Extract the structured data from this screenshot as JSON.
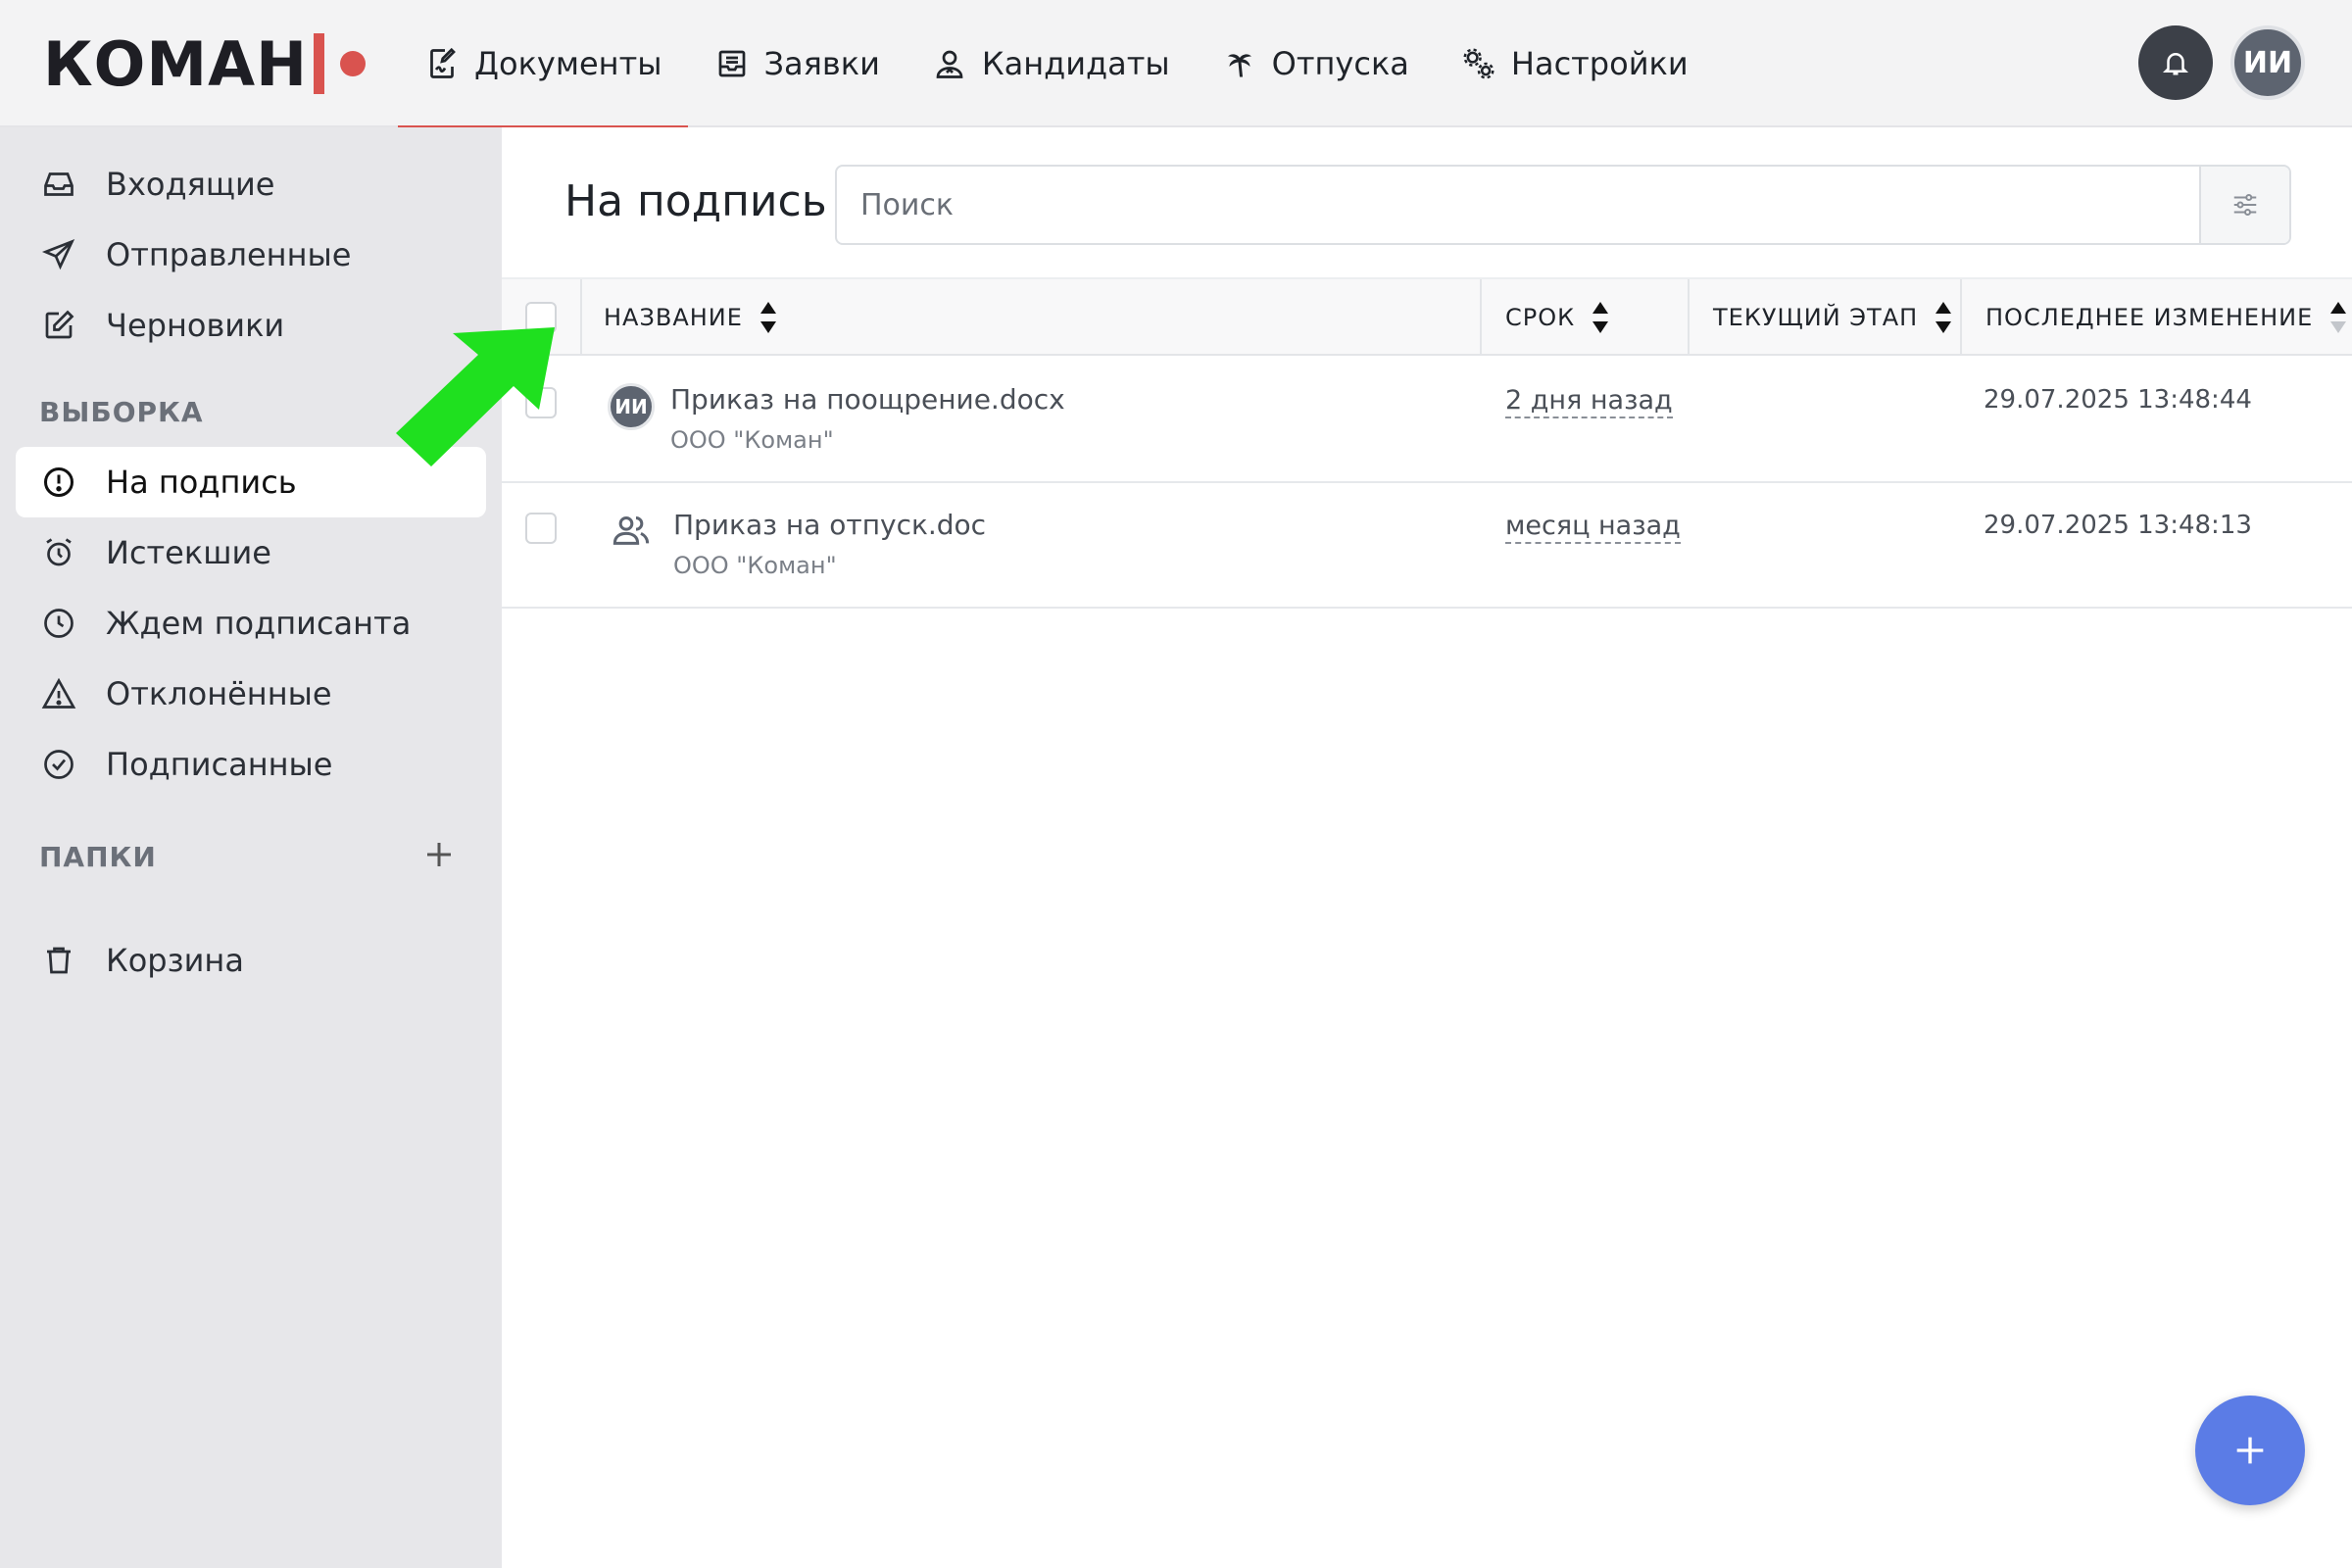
{
  "app": {
    "logo_text": "КОМАН"
  },
  "colors": {
    "brand": "#d9534f",
    "fab": "#5b7ce6",
    "annotation_arrow": "#1fe01f"
  },
  "nav": {
    "items": [
      {
        "label": "Документы",
        "icon": "document-sign-icon",
        "active": true
      },
      {
        "label": "Заявки",
        "icon": "tray-icon"
      },
      {
        "label": "Кандидаты",
        "icon": "user-icon"
      },
      {
        "label": "Отпуска",
        "icon": "palm-tree-icon"
      },
      {
        "label": "Настройки",
        "icon": "gears-icon"
      }
    ]
  },
  "user": {
    "initials": "ИИ"
  },
  "sidebar": {
    "mailbox": [
      {
        "label": "Входящие",
        "icon": "inbox-icon"
      },
      {
        "label": "Отправленные",
        "icon": "send-icon"
      },
      {
        "label": "Черновики",
        "icon": "edit-icon"
      }
    ],
    "selection_header": "ВЫБОРКА",
    "selection": [
      {
        "label": "На подпись",
        "icon": "alert-circle-icon",
        "active": true
      },
      {
        "label": "Истекшие",
        "icon": "alarm-icon"
      },
      {
        "label": "Ждем подписанта",
        "icon": "clock-icon"
      },
      {
        "label": "Отклонённые",
        "icon": "warning-icon"
      },
      {
        "label": "Подписанные",
        "icon": "check-circle-icon"
      }
    ],
    "folders_header": "ПАПКИ",
    "trash": {
      "label": "Корзина",
      "icon": "trash-icon"
    }
  },
  "main": {
    "title": "На подпись",
    "search_placeholder": "Поиск",
    "columns": {
      "name": "НАЗВАНИЕ",
      "deadline": "СРОК",
      "stage": "ТЕКУЩИЙ ЭТАП",
      "changed": "ПОСЛЕДНЕЕ ИЗМЕНЕНИЕ"
    },
    "rows": [
      {
        "avatar": "ИИ",
        "title": "Приказ на поощрение.docx",
        "org": "ООО \"Коман\"",
        "deadline": "2 дня назад",
        "stage": "",
        "changed": "29.07.2025 13:48:44"
      },
      {
        "avatar": "",
        "title": "Приказ на отпуск.doc",
        "org": "ООО \"Коман\"",
        "deadline": "месяц назад",
        "stage": "",
        "changed": "29.07.2025 13:48:13"
      }
    ]
  }
}
